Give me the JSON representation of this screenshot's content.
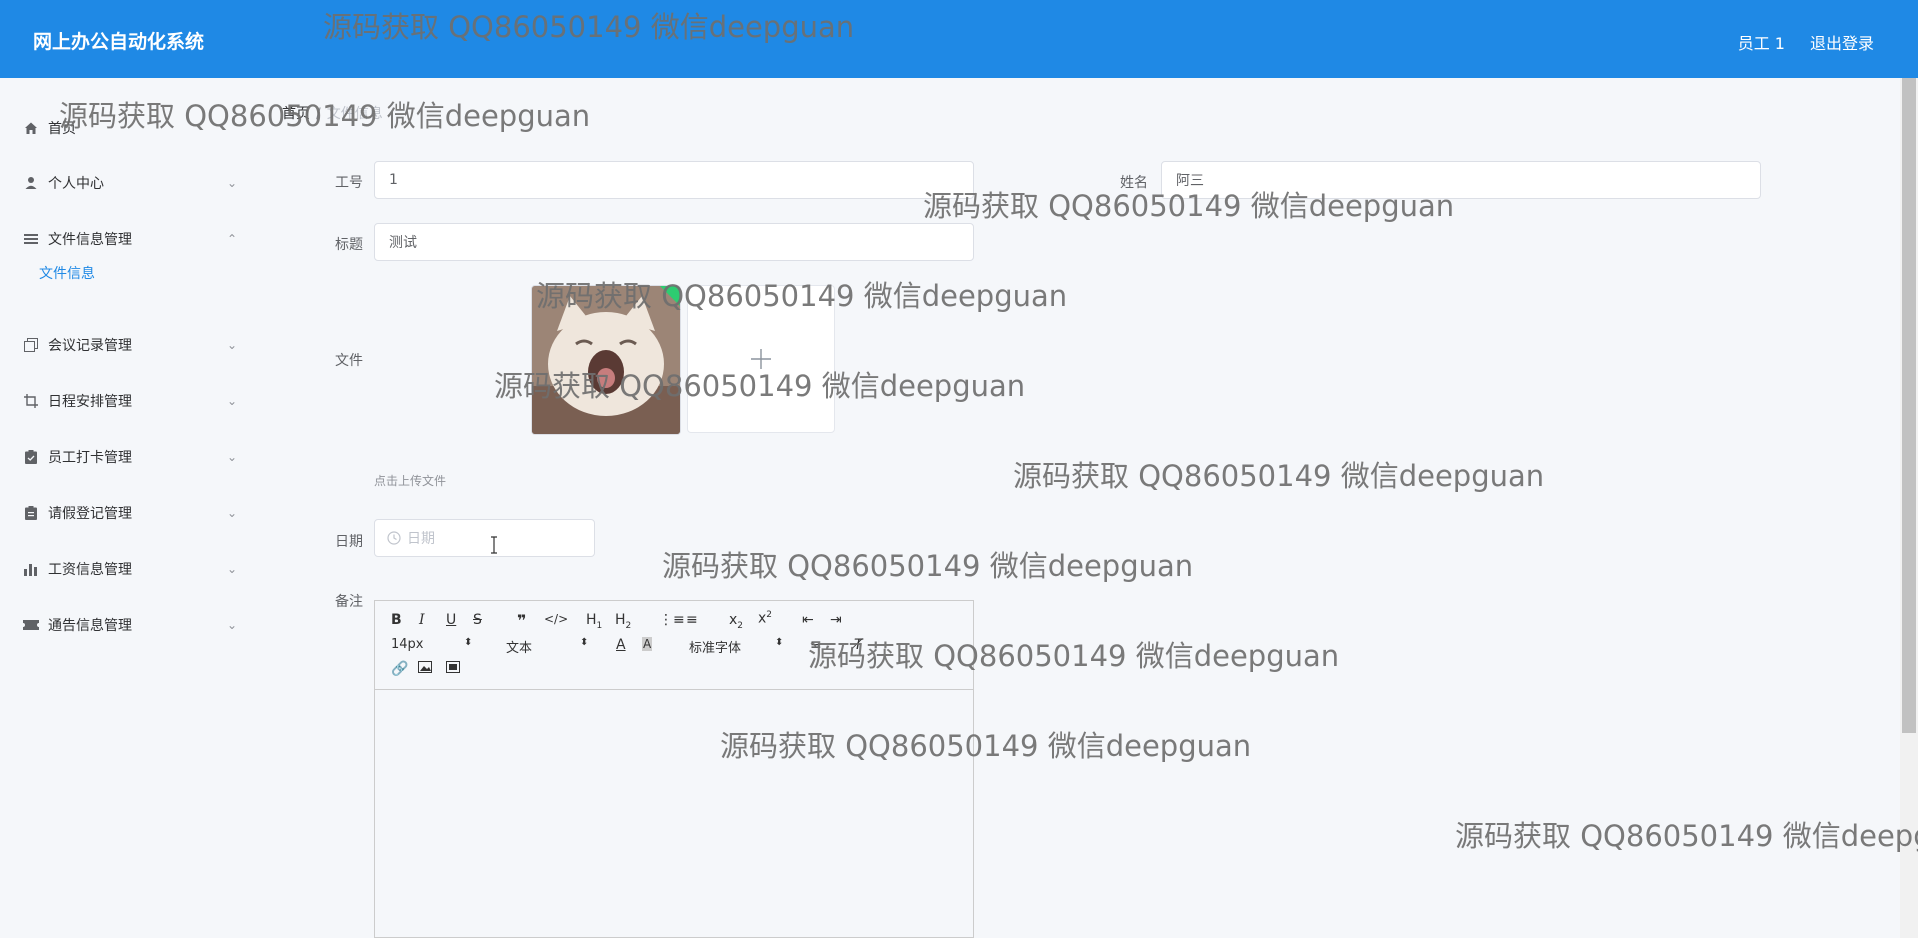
{
  "header": {
    "title": "网上办公自动化系统",
    "user_label": "员工 1",
    "logout_label": "退出登录"
  },
  "sidebar": {
    "items": [
      {
        "label": "首页",
        "icon": "home-icon"
      },
      {
        "label": "个人中心",
        "icon": "user-icon"
      },
      {
        "label": "文件信息管理",
        "icon": "list-icon"
      },
      {
        "label": "会议记录管理",
        "icon": "copy-icon"
      },
      {
        "label": "日程安排管理",
        "icon": "crop-icon"
      },
      {
        "label": "员工打卡管理",
        "icon": "clipboard-icon"
      },
      {
        "label": "请假登记管理",
        "icon": "document-icon"
      },
      {
        "label": "工资信息管理",
        "icon": "bar-chart-icon"
      },
      {
        "label": "通告信息管理",
        "icon": "ticket-icon"
      }
    ],
    "submenu": {
      "label": "文件信息"
    }
  },
  "breadcrumb": {
    "home": "首页",
    "separator": "/",
    "current": "文件信息"
  },
  "form": {
    "employee_id": {
      "label": "工号",
      "value": "1"
    },
    "name": {
      "label": "姓名",
      "value": "阿三"
    },
    "title": {
      "label": "标题",
      "value": "测试"
    },
    "file": {
      "label": "文件",
      "tip": "点击上传文件"
    },
    "date": {
      "label": "日期",
      "placeholder": "日期"
    },
    "remark": {
      "label": "备注"
    }
  },
  "editor": {
    "font_size": "14px",
    "heading": "文本",
    "font_family": "标准字体"
  },
  "watermark": "源码获取 QQ86050149 微信deepguan"
}
